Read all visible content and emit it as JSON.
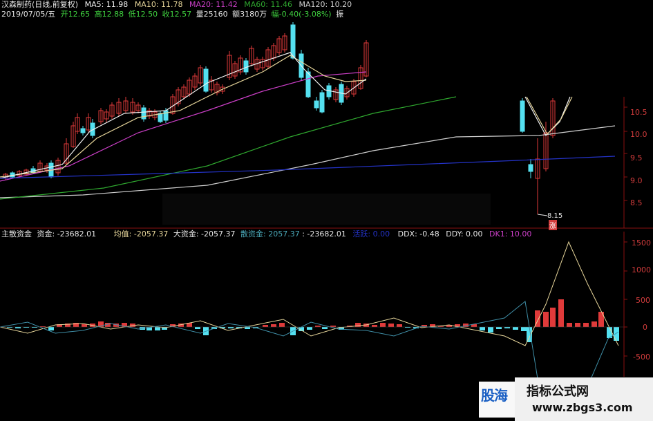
{
  "header": {
    "stock_title": "汉森制药(日线,前复权)",
    "date_line": "2019/07/05/五",
    "ma5": "MA5: 11.98",
    "ma10": "MA10: 11.78",
    "ma20": "MA20: 11.42",
    "ma60": "MA60: 11.46",
    "ma120": "MA120: 10.20",
    "open": "开12.65",
    "high": "高12.88",
    "low": "低12.50",
    "close": "收12.57",
    "volume": "量25160",
    "amount": "额3180万",
    "change": "幅-0.40(-3.08%)",
    "amplitude": "振"
  },
  "price_axis": [
    "10.5",
    "10.0",
    "9.5",
    "9.0",
    "8.5"
  ],
  "annotations": {
    "low_marker": "8.15",
    "limit_tag": "涨"
  },
  "indicator": {
    "name": "主散资金",
    "fund": "资金: -23682.01",
    "avg": "均值: -2057.37",
    "big_fund": "大资金: -2057.37",
    "retail_fund": "散资金: 2057.37",
    "retail_extra": ": -23682.01",
    "retail_extra2": "活跃: 0.00",
    "ddx": "DDX: -0.48",
    "ddy": "DDY: 0.00",
    "dk1": "DK1: 10.00"
  },
  "indicator_axis": [
    "1500",
    "1000",
    "500",
    "0",
    "-500"
  ],
  "watermark": {
    "title": "指标公式网",
    "url": "www.zbgs3.com",
    "logo": "股海"
  },
  "colors": {
    "up": "#e03a3a",
    "down": "#54e0f0",
    "ma5": "#f0f0f0",
    "ma10": "#e6d59a",
    "ma20": "#cc3fc8",
    "ma60": "#2fa82f",
    "ma120": "#d0d0d0",
    "ma250": "#2433c8",
    "axis_red": "#d23c3c"
  }
}
